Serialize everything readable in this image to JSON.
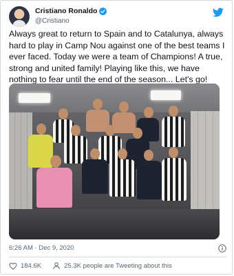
{
  "tweet": {
    "author_name": "Cristiano Ronaldo",
    "handle": "@Cristiano",
    "text": "Always great to return to Spain and to Catalunya, always hard to play in Camp Nou against one of the best teams I ever faced. Today we were a team of Champions! A true, strong and united family! Playing like this, we have nothing to fear until the end of the season... Let's go!",
    "timestamp": "6:26 AM · Dec 9, 2020"
  },
  "actions": {
    "likes": "184.6K",
    "tweeting": "25.3K people are Tweeting about this"
  },
  "icons": {
    "verified": "verified-badge-icon",
    "brand": "twitter-bird-icon",
    "info": "info-icon",
    "like": "heart-icon",
    "tweeting": "person-icon"
  },
  "colors": {
    "accent": "#1d9bf0",
    "text": "#0f1419",
    "secondary": "#536471",
    "border": "#cfd9de"
  }
}
